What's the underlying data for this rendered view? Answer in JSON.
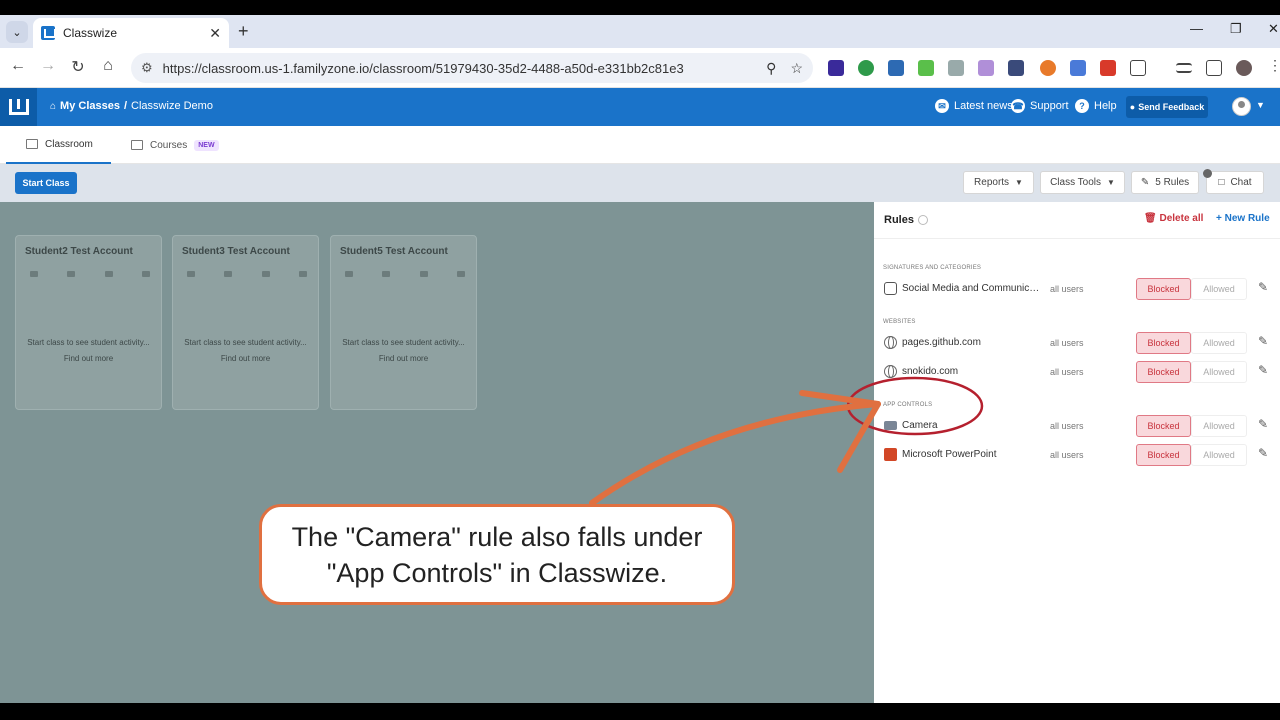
{
  "browser": {
    "tab_title": "Classwize",
    "url": "https://classroom.us-1.familyzone.io/classroom/51979430-35d2-4488-a50d-e331bb2c81e3"
  },
  "header": {
    "breadcrumb_root": "My Classes",
    "breadcrumb_sep": "/",
    "breadcrumb_current": "Classwize Demo",
    "latest_news": "Latest news",
    "support": "Support",
    "help": "Help",
    "send_feedback": "Send Feedback"
  },
  "tabs": {
    "classroom": "Classroom",
    "courses": "Courses",
    "new_badge": "NEW"
  },
  "toolbar": {
    "start_class": "Start Class",
    "reports": "Reports",
    "class_tools": "Class Tools",
    "rules": "5 Rules",
    "chat": "Chat"
  },
  "students": [
    {
      "name": "Student2 Test Account",
      "message": "Start class to see student activity...",
      "link": "Find out more"
    },
    {
      "name": "Student3 Test Account",
      "message": "Start class to see student activity...",
      "link": "Find out more"
    },
    {
      "name": "Student5 Test Account",
      "message": "Start class to see student activity...",
      "link": "Find out more"
    }
  ],
  "rules_panel": {
    "title": "Rules",
    "delete_all": "Delete all",
    "new_rule": "New Rule",
    "section_signatures": "SIGNATURES AND CATEGORIES",
    "section_websites": "WEBSITES",
    "section_apps": "APP CONTROLS",
    "rules": [
      {
        "name": "Social Media and Communica...",
        "scope": "all users",
        "blocked": "Blocked",
        "allowed": "Allowed"
      },
      {
        "name": "pages.github.com",
        "scope": "all users",
        "blocked": "Blocked",
        "allowed": "Allowed"
      },
      {
        "name": "snokido.com",
        "scope": "all users",
        "blocked": "Blocked",
        "allowed": "Allowed"
      },
      {
        "name": "Camera",
        "scope": "all users",
        "blocked": "Blocked",
        "allowed": "Allowed"
      },
      {
        "name": "Microsoft PowerPoint",
        "scope": "all users",
        "blocked": "Blocked",
        "allowed": "Allowed"
      }
    ]
  },
  "annotation": {
    "text": "The \"Camera\" rule also falls under \"App Controls\" in Classwize."
  },
  "colors": {
    "brand": "#1a73c9",
    "blocked": "#c8343e",
    "annotation": "#e07040",
    "highlight_circle": "#b5202e"
  }
}
